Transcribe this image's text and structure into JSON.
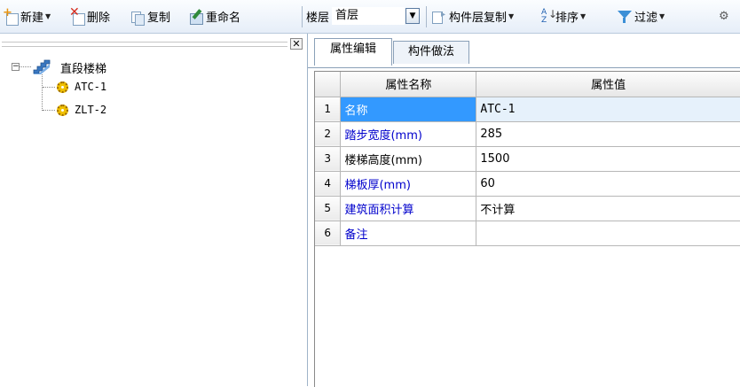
{
  "toolbar": {
    "new_label": "新建",
    "delete_label": "删除",
    "copy_label": "复制",
    "rename_label": "重命名",
    "floor_label": "楼层",
    "floor_value": "首层",
    "layer_copy_label": "构件层复制",
    "sort_label": "排序",
    "filter_label": "过滤",
    "icons": [
      "new-icon",
      "delete-icon",
      "copy-icon",
      "rename-icon",
      "layer-copy-icon",
      "sort-icon",
      "filter-icon"
    ]
  },
  "tree": {
    "root": {
      "label": "直段楼梯",
      "expander": "−",
      "icon": "stair-icon"
    },
    "children": [
      {
        "label": "ATC-1",
        "icon": "gear-icon"
      },
      {
        "label": "ZLT-2",
        "icon": "gear-icon"
      }
    ]
  },
  "tabs": [
    {
      "label": "属性编辑",
      "active": true
    },
    {
      "label": "构件做法",
      "active": false
    }
  ],
  "grid": {
    "columns": [
      "属性名称",
      "属性值"
    ],
    "rows": [
      {
        "num": "1",
        "name": "名称",
        "value": "ATC-1"
      },
      {
        "num": "2",
        "name": "踏步宽度(mm)",
        "value": "285"
      },
      {
        "num": "3",
        "name": "楼梯高度(mm)",
        "value": "1500"
      },
      {
        "num": "4",
        "name": "梯板厚(mm)",
        "value": "60"
      },
      {
        "num": "5",
        "name": "建筑面积计算",
        "value": "不计算"
      },
      {
        "num": "6",
        "name": "备注",
        "value": ""
      }
    ]
  },
  "colors": {
    "selection": "#3399ff",
    "link_text": "#0000cc",
    "value_highlight": "#e6f1fb"
  }
}
